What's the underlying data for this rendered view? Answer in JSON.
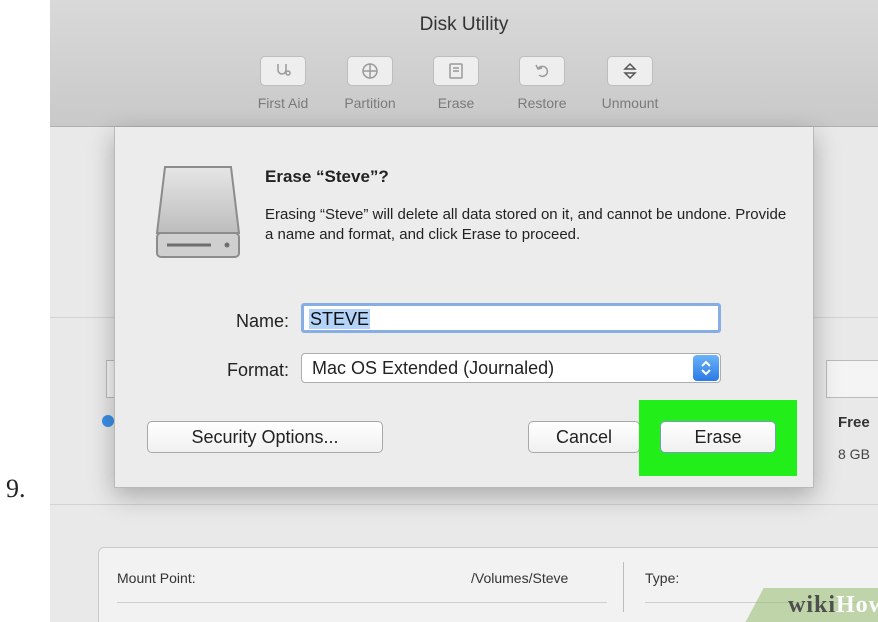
{
  "step": {
    "number": "9."
  },
  "window": {
    "title": "Disk Utility"
  },
  "toolbar": {
    "buttons": [
      {
        "label": "First Aid",
        "icon": "stethoscope-icon"
      },
      {
        "label": "Partition",
        "icon": "partition-icon"
      },
      {
        "label": "Erase",
        "icon": "erase-icon"
      },
      {
        "label": "Restore",
        "icon": "restore-icon"
      },
      {
        "label": "Unmount",
        "icon": "eject-icon"
      }
    ]
  },
  "dialog": {
    "title": "Erase “Steve”?",
    "message": "Erasing “Steve” will delete all data stored on it, and cannot be undone. Provide a name and format, and click Erase to proceed.",
    "name_label": "Name:",
    "name_value": "STEVE",
    "format_label": "Format:",
    "format_value": "Mac OS Extended (Journaled)",
    "security_label": "Security Options...",
    "cancel_label": "Cancel",
    "erase_label": "Erase",
    "highlight_color": "#22ee1a"
  },
  "background": {
    "free_label": "Free",
    "free_value": "8 GB",
    "info": {
      "mount_point_label": "Mount Point:",
      "mount_point_value": "/Volumes/Steve",
      "type_label": "Type:"
    }
  },
  "watermark": {
    "part1": "wiki",
    "part2": "How"
  }
}
